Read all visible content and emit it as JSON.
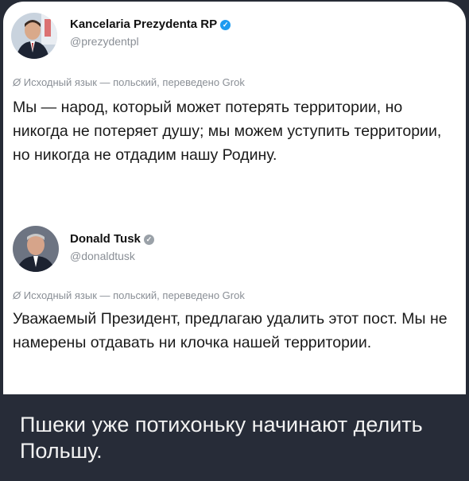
{
  "tweet1": {
    "name": "Kancelaria Prezydenta RP",
    "handle": "@prezydentpl",
    "translation_note": "Исходный язык — польский, переведено Grok",
    "text": "Мы — народ, который может потерять территории, но никогда не потеряет душу; мы можем уступить территории, но никогда не отдадим нашу Родину."
  },
  "tweet2": {
    "name": "Donald Tusk",
    "handle": "@donaldtusk",
    "translation_note": "Исходный язык — польский, переведено Grok",
    "text": "Уважаемый Президент, предлагаю удалить этот пост. Мы не намерены отдавать ни клочка нашей территории."
  },
  "caption": "Пшеки уже потихоньку начинают делить Польшу.",
  "colors": {
    "verified_blue": "#1d9bf0",
    "verified_gray": "#9aa1a8",
    "caption_bg": "#272c38"
  }
}
